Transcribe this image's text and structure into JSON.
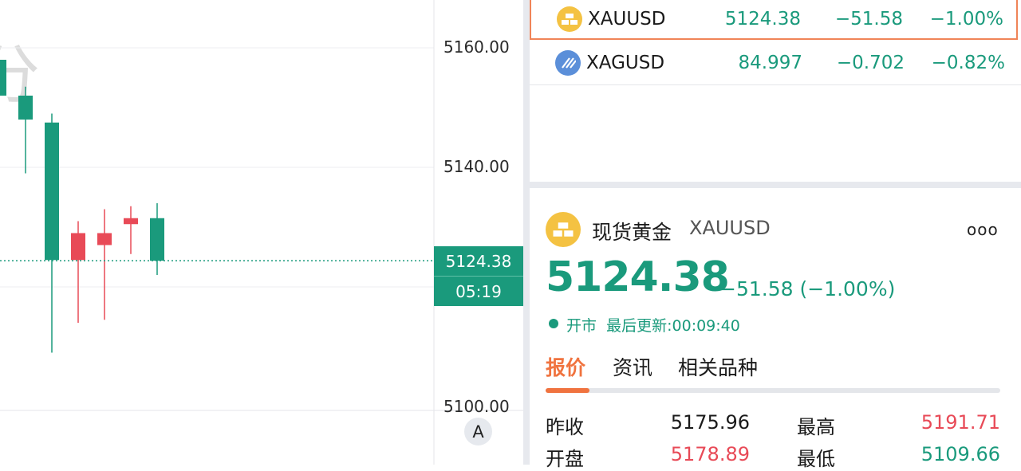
{
  "chart": {
    "watermark": "分",
    "axis_labels": [
      "5160.00",
      "5140.00",
      "5100.00"
    ],
    "current_price": "5124.38",
    "countdown": "05:19",
    "axis_mode": "A",
    "candles": [
      {
        "open": 5158,
        "close": 5152,
        "high": 5161,
        "low": 5146
      },
      {
        "open": 5152,
        "close": 5148,
        "high": 5153.5,
        "low": 5139
      },
      {
        "open": 5147.5,
        "close": 5124.5,
        "high": 5149,
        "low": 5109
      },
      {
        "open": 5124.5,
        "close": 5129,
        "high": 5131,
        "low": 5114
      },
      {
        "open": 5127,
        "close": 5129,
        "high": 5133,
        "low": 5114.5
      },
      {
        "open": 5130.5,
        "close": 5131.5,
        "high": 5133.5,
        "low": 5125.5
      },
      {
        "open": 5131.5,
        "close": 5124.38,
        "high": 5134,
        "low": 5122
      }
    ],
    "colors": {
      "up": "#e84a57",
      "down": "#1a9a7c"
    }
  },
  "watchlist": [
    {
      "symbol": "XAUUSD",
      "price": "5124.38",
      "change": "−51.58",
      "pct": "−1.00%",
      "icon": "gold-bars-icon",
      "selected": true
    },
    {
      "symbol": "XAGUSD",
      "price": "84.997",
      "change": "−0.702",
      "pct": "−0.82%",
      "icon": "silver-bars-icon",
      "selected": false
    }
  ],
  "detail": {
    "name": "现货黄金",
    "code": "XAUUSD",
    "more": "ooo",
    "price": "5124.38",
    "change": "−51.58 (−1.00%)",
    "market_state": "开市",
    "last_update": "最后更新:00:09:40",
    "tabs": [
      "报价",
      "资讯",
      "相关品种"
    ],
    "quotes": [
      {
        "label": "昨收",
        "value": "5175.96",
        "color": "#1a1a1a"
      },
      {
        "label": "最高",
        "value": "5191.71",
        "color": "#e84a57"
      },
      {
        "label": "开盘",
        "value": "5178.89",
        "color": "#e84a57"
      },
      {
        "label": "最低",
        "value": "5109.66",
        "color": "#1a9a7c"
      }
    ]
  }
}
